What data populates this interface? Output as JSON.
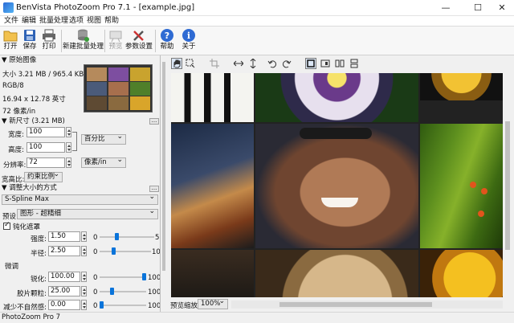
{
  "window": {
    "title": "BenVista PhotoZoom Pro 7.1 - [example.jpg]",
    "minimize": "—",
    "maximize": "☐",
    "close": "✕"
  },
  "menu": [
    "文件",
    "编辑",
    "批量处理",
    "选项",
    "视图",
    "帮助"
  ],
  "toolbar": {
    "open": "打开",
    "save": "保存",
    "print": "打印",
    "new_batch": "新建批量处理",
    "preview": "预览",
    "settings": "参数设置",
    "help": "帮助",
    "about": "关于"
  },
  "original": {
    "header": "原始图像",
    "size": "大小 3.21 MB / 965.4 KB",
    "color": "RGB/8",
    "dimensions": "16.94 x 12.78 英寸",
    "resolution": "72 像素/in"
  },
  "newsize": {
    "header": "新尺寸 (3.21 MB)",
    "width_label": "宽度:",
    "width_value": "100",
    "height_label": "高度:",
    "height_value": "100",
    "res_label": "分辨率:",
    "res_value": "72",
    "unit_percent": "百分比",
    "unit_ppi": "像素/in",
    "aspect_label": "宽高比:",
    "aspect_value": "约束比例"
  },
  "method": {
    "header": "调整大小的方式",
    "algorithm": "S-Spline Max",
    "preset_label": "预设:",
    "preset_value": "图形 - 超精细",
    "unsharp_label": "钝化遮罩",
    "strength_label": "强度:",
    "strength_value": "1.50",
    "strength_min": "0",
    "strength_max": "5",
    "strength_level": 0.3,
    "radius_label": "半径:",
    "radius_value": "2.50",
    "radius_min": "0",
    "radius_max": "10",
    "radius_level": 0.25,
    "fine_label": "微调",
    "sharp_label": "锐化:",
    "sharp_value": "100.00",
    "sharp_min": "0",
    "sharp_max": "100",
    "sharp_level": 1.0,
    "film_label": "胶片颗粒:",
    "film_value": "25.00",
    "film_min": "0",
    "film_max": "100",
    "film_level": 0.25,
    "artifact_label": "减少不自然感:",
    "artifact_value": "0.00",
    "artifact_min": "0",
    "artifact_max": "100",
    "artifact_level": 0.0
  },
  "preview_zoom": {
    "label": "预览缩放:",
    "value": "100%"
  },
  "status": "PhotoZoom Pro 7",
  "colors": {
    "accent": "#0a74da",
    "titlebar": "#ffffff",
    "panel": "#f0f0f0"
  }
}
